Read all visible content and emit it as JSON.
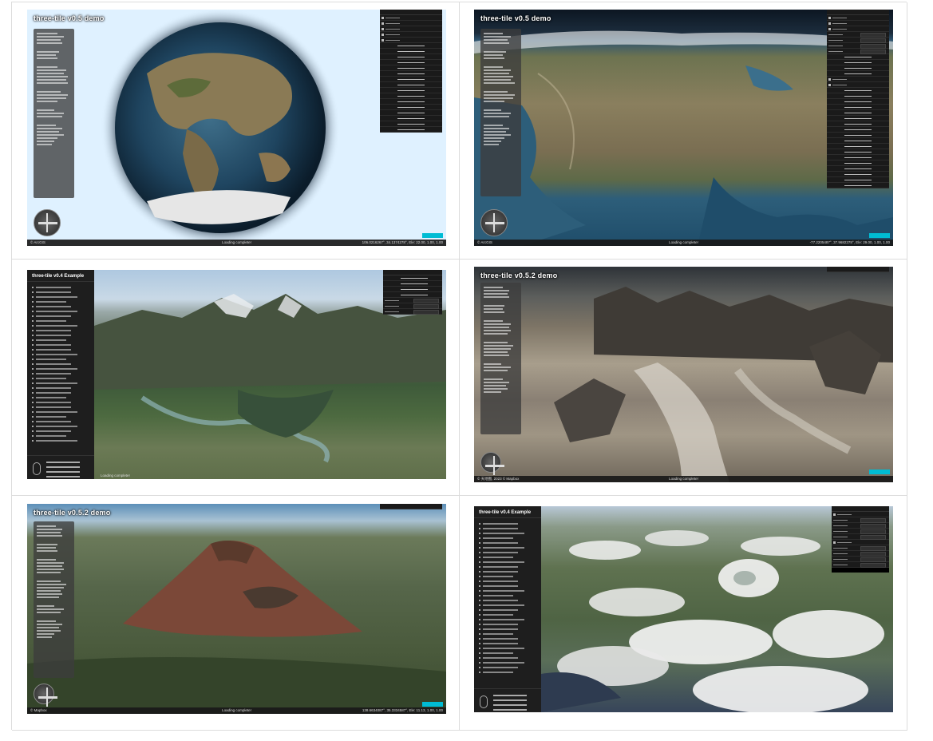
{
  "shots": [
    {
      "title": "three-tile v0.5 demo",
      "status": {
        "left": "© ArcGIS",
        "center": "Loading complete!",
        "right": "106.0216267°, 34.1374278°, Ele: 22.00, 1.00, 1.00"
      }
    },
    {
      "title": "three-tile v0.5 demo",
      "status": {
        "left": "© ArcGIS",
        "center": "Loading complete!",
        "right": "-77.2205487°, 37.9682378°, Ele: 29.00, 1.00, 1.00"
      }
    },
    {
      "title": "three-tile v0.4 Example",
      "status": {
        "left": "",
        "center": "Loading complete!",
        "right": ""
      }
    },
    {
      "title": "three-tile v0.5.2 demo",
      "status": {
        "left": "© 天地图, 2023 © Mapbox",
        "center": "Loading complete!",
        "right": ""
      }
    },
    {
      "title": "three-tile v0.5.2 demo",
      "status": {
        "left": "© Mapbox",
        "center": "Loading complete!",
        "right": "138.6634087°, 35.3334587°, Ele: 11.13, 1.00, 1.00"
      }
    },
    {
      "title": "three-tile v0.4 Example",
      "status": {
        "left": "",
        "center": "",
        "right": ""
      }
    }
  ]
}
